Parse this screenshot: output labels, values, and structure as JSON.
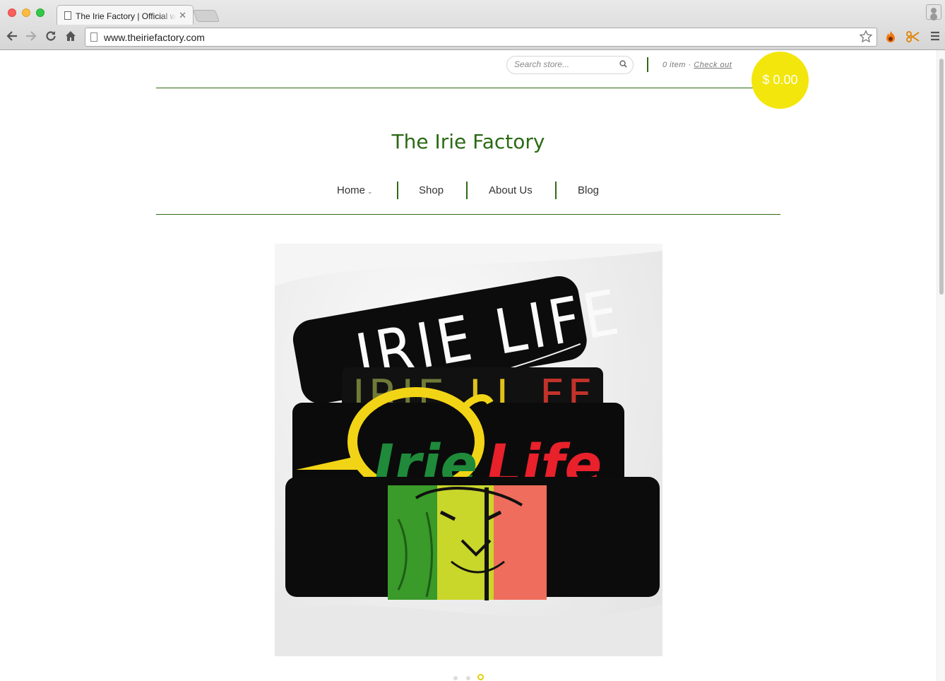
{
  "browser": {
    "tab_title": "The Irie Factory | Official website",
    "tab_close": "✕",
    "url": "www.theiriefactory.com",
    "back_icon": "back-arrow-icon",
    "forward_icon": "forward-arrow-icon",
    "reload_icon": "reload-icon",
    "home_icon": "home-icon",
    "star_icon": "bookmark-star-icon"
  },
  "header": {
    "search_placeholder": "Search store...",
    "cart_count": "0 item",
    "cart_separator": "·",
    "checkout_label": "Check out",
    "cart_total": "$ 0.00"
  },
  "site": {
    "title": "The Irie Factory"
  },
  "nav": {
    "items": [
      {
        "label": "Home",
        "has_dropdown": true
      },
      {
        "label": "Shop"
      },
      {
        "label": "About Us"
      },
      {
        "label": "Blog"
      }
    ]
  },
  "hero": {
    "shirt_texts": [
      "IRIE LIFE",
      "IRIE LIFE",
      "Irie",
      "Life"
    ]
  },
  "slider": {
    "slide_count": 3,
    "active_index": 2
  },
  "colors": {
    "brand_green": "#2b6a14",
    "cart_yellow": "#f3e60c",
    "shirt_green": "#1f8a3a",
    "shirt_red": "#e8212b",
    "shirt_yellow": "#f2d416"
  }
}
